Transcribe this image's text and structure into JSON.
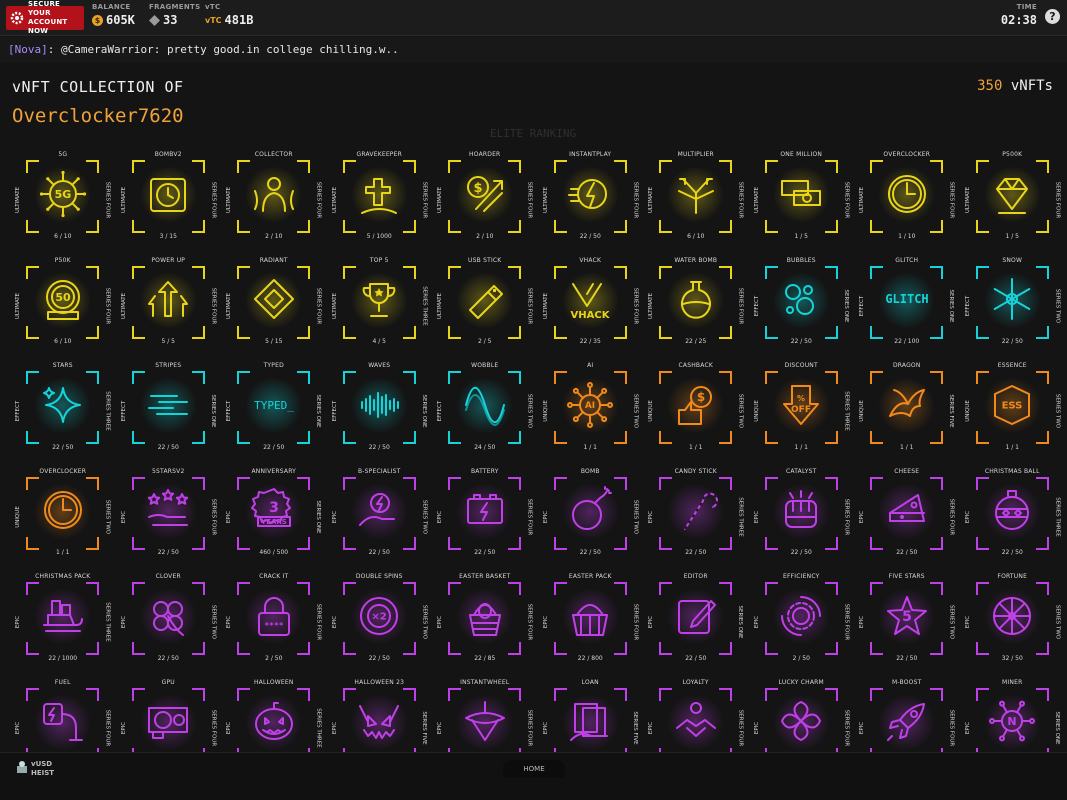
{
  "topbar": {
    "secure_line1": "SECURE YOUR",
    "secure_line2": "ACCOUNT NOW",
    "balance_label": "BALANCE",
    "balance_value": "605K",
    "fragments_label": "FRAGMENTS",
    "fragments_value": "33",
    "vtc_label": "vTC",
    "vtc_value": "481B",
    "time_label": "TIME",
    "time_value": "02:38",
    "help": "?"
  },
  "chat": {
    "channel": "[Nova]",
    "message": ": @CameraWarrior: pretty good.in college chilling.w.."
  },
  "collection": {
    "title": "vNFT COLLECTION OF",
    "owner": "Overclocker7620",
    "count": "350",
    "count_label": "vNFTs",
    "background_heading": "ELITE RANKING"
  },
  "colors": {
    "ultimate": "#e8d51a",
    "effect": "#16d3d8",
    "unique": "#f08a1c",
    "epic": "#c040e8"
  },
  "cards": [
    {
      "name": "5G",
      "tier": "ULTIMATE",
      "series": "SERIES FOUR",
      "count": "6 / 10",
      "rarity": "ultimate",
      "icon": "5g-icon",
      "sym": "5G"
    },
    {
      "name": "BOMBV2",
      "tier": "ULTIMATE",
      "series": "SERIES FOUR",
      "count": "3 / 15",
      "rarity": "ultimate",
      "icon": "time-bomb-icon",
      "sym": "clock"
    },
    {
      "name": "COLLECTOR",
      "tier": "ULTIMATE",
      "series": "SERIES FOUR",
      "count": "2 / 10",
      "rarity": "ultimate",
      "icon": "collector-icon",
      "sym": "person"
    },
    {
      "name": "GRAVEKEEPER",
      "tier": "ULTIMATE",
      "series": "SERIES FOUR",
      "count": "5 / 1000",
      "rarity": "ultimate",
      "icon": "grave-icon",
      "sym": "grave"
    },
    {
      "name": "HOARDER",
      "tier": "ULTIMATE",
      "series": "SERIES FOUR",
      "count": "2 / 10",
      "rarity": "ultimate",
      "icon": "hoarder-icon",
      "sym": "dollar-arrows"
    },
    {
      "name": "INSTANTPLAY",
      "tier": "ULTIMATE",
      "series": "SERIES FOUR",
      "count": "22 / 50",
      "rarity": "ultimate",
      "icon": "instant-play-icon",
      "sym": "bolt-clock"
    },
    {
      "name": "MULTIPLIER",
      "tier": "ULTIMATE",
      "series": "SERIES FOUR",
      "count": "6 / 10",
      "rarity": "ultimate",
      "icon": "multiplier-icon",
      "sym": "arrows"
    },
    {
      "name": "ONE MILLION",
      "tier": "ULTIMATE",
      "series": "SERIES FOUR",
      "count": "1 / 5",
      "rarity": "ultimate",
      "icon": "one-million-icon",
      "sym": "money"
    },
    {
      "name": "OVERCLOCKER",
      "tier": "ULTIMATE",
      "series": "SERIES FOUR",
      "count": "1 / 10",
      "rarity": "ultimate",
      "icon": "clock-icon",
      "sym": "clock-face"
    },
    {
      "name": "P500K",
      "tier": "ULTIMATE",
      "series": "SERIES FOUR",
      "count": "1 / 5",
      "rarity": "ultimate",
      "icon": "diamond-icon",
      "sym": "diamond"
    },
    {
      "name": "P50K",
      "tier": "ULTIMATE",
      "series": "SERIES FOUR",
      "count": "6 / 10",
      "rarity": "ultimate",
      "icon": "p50k-badge-icon",
      "sym": "50"
    },
    {
      "name": "POWER UP",
      "tier": "ULTIMATE",
      "series": "SERIES FOUR",
      "count": "5 / 5",
      "rarity": "ultimate",
      "icon": "power-up-icon",
      "sym": "up-arrows"
    },
    {
      "name": "RADIANT",
      "tier": "ULTIMATE",
      "series": "SERIES FOUR",
      "count": "5 / 15",
      "rarity": "ultimate",
      "icon": "radiant-icon",
      "sym": "rhombus"
    },
    {
      "name": "TOP 5",
      "tier": "ULTIMATE",
      "series": "SERIES THREE",
      "count": "4 / 5",
      "rarity": "ultimate",
      "icon": "trophy-icon",
      "sym": "trophy"
    },
    {
      "name": "USB STICK",
      "tier": "ULTIMATE",
      "series": "SERIES FOUR",
      "count": "2 / 5",
      "rarity": "ultimate",
      "icon": "usb-stick-icon",
      "sym": "usb"
    },
    {
      "name": "VHACK",
      "tier": "ULTIMATE",
      "series": "SERIES FOUR",
      "count": "22 / 35",
      "rarity": "ultimate",
      "icon": "vhack-logo-icon",
      "sym": "vhack"
    },
    {
      "name": "WATER BOMB",
      "tier": "ULTIMATE",
      "series": "SERIES FOUR",
      "count": "22 / 25",
      "rarity": "ultimate",
      "icon": "water-bomb-icon",
      "sym": "flask"
    },
    {
      "name": "BUBBLES",
      "tier": "EFFECT",
      "series": "SERIES ONE",
      "count": "22 / 50",
      "rarity": "effect",
      "icon": "bubbles-icon",
      "sym": "bubbles"
    },
    {
      "name": "GLITCH",
      "tier": "EFFECT",
      "series": "SERIES ONE",
      "count": "22 / 100",
      "rarity": "effect",
      "icon": "glitch-icon",
      "sym": "GLITCH"
    },
    {
      "name": "SNOW",
      "tier": "EFFECT",
      "series": "SERIES TWO",
      "count": "22 / 50",
      "rarity": "effect",
      "icon": "snowflake-icon",
      "sym": "snow"
    },
    {
      "name": "STARS",
      "tier": "EFFECT",
      "series": "SERIES THREE",
      "count": "22 / 50",
      "rarity": "effect",
      "icon": "stars-icon",
      "sym": "stars"
    },
    {
      "name": "STRIPES",
      "tier": "EFFECT",
      "series": "SERIES ONE",
      "count": "22 / 50",
      "rarity": "effect",
      "icon": "stripes-icon",
      "sym": "stripes"
    },
    {
      "name": "TYPED",
      "tier": "EFFECT",
      "series": "SERIES ONE",
      "count": "22 / 50",
      "rarity": "effect",
      "icon": "typed-icon",
      "sym": "TYPED_"
    },
    {
      "name": "WAVES",
      "tier": "EFFECT",
      "series": "SERIES ONE",
      "count": "22 / 50",
      "rarity": "effect",
      "icon": "sound-wave-icon",
      "sym": "wave"
    },
    {
      "name": "WOBBLE",
      "tier": "EFFECT",
      "series": "SERIES TWO",
      "count": "24 / 50",
      "rarity": "effect",
      "icon": "wobble-icon",
      "sym": "sine"
    },
    {
      "name": "AI",
      "tier": "UNIQUE",
      "series": "SERIES TWO",
      "count": "1 / 1",
      "rarity": "unique",
      "icon": "ai-chip-icon",
      "sym": "AI"
    },
    {
      "name": "CASHBACK",
      "tier": "UNIQUE",
      "series": "SERIES TWO",
      "count": "1 / 1",
      "rarity": "unique",
      "icon": "cashback-icon",
      "sym": "thumb-dollar"
    },
    {
      "name": "DISCOUNT",
      "tier": "UNIQUE",
      "series": "SERIES THREE",
      "count": "1 / 1",
      "rarity": "unique",
      "icon": "discount-icon",
      "sym": "OFF"
    },
    {
      "name": "DRAGON",
      "tier": "UNIQUE",
      "series": "SERIES FIVE",
      "count": "1 / 1",
      "rarity": "unique",
      "icon": "dragon-icon",
      "sym": "dragon"
    },
    {
      "name": "ESSENCE",
      "tier": "UNIQUE",
      "series": "SERIES TWO",
      "count": "1 / 1",
      "rarity": "unique",
      "icon": "essence-icon",
      "sym": "ess"
    },
    {
      "name": "OVERCLOCKER",
      "tier": "UNIQUE",
      "series": "SERIES TWO",
      "count": "1 / 1",
      "rarity": "unique",
      "icon": "clock-icon",
      "sym": "clock-face"
    },
    {
      "name": "5STARSV2",
      "tier": "EPIC",
      "series": "SERIES FOUR",
      "count": "22 / 50",
      "rarity": "epic",
      "icon": "five-stars-icon",
      "sym": "5stars"
    },
    {
      "name": "ANNIVERSARY",
      "tier": "EPIC",
      "series": "SERIES ONE",
      "count": "460 / 500",
      "rarity": "epic",
      "icon": "anniversary-badge-icon",
      "sym": "3years"
    },
    {
      "name": "B-SPECIALIST",
      "tier": "EPIC",
      "series": "SERIES TWO",
      "count": "22 / 50",
      "rarity": "epic",
      "icon": "b-specialist-icon",
      "sym": "hand-bolt"
    },
    {
      "name": "BATTERY",
      "tier": "EPIC",
      "series": "SERIES FOUR",
      "count": "22 / 50",
      "rarity": "epic",
      "icon": "battery-icon",
      "sym": "battery"
    },
    {
      "name": "BOMB",
      "tier": "EPIC",
      "series": "SERIES TWO",
      "count": "22 / 50",
      "rarity": "epic",
      "icon": "bomb-icon",
      "sym": "bomb"
    },
    {
      "name": "CANDY STICK",
      "tier": "EPIC",
      "series": "SERIES THREE",
      "count": "22 / 50",
      "rarity": "epic",
      "icon": "candy-cane-icon",
      "sym": "cane"
    },
    {
      "name": "CATALYST",
      "tier": "EPIC",
      "series": "SERIES FOUR",
      "count": "22 / 50",
      "rarity": "epic",
      "icon": "catalyst-icon",
      "sym": "fist"
    },
    {
      "name": "CHEESE",
      "tier": "EPIC",
      "series": "SERIES FOUR",
      "count": "22 / 50",
      "rarity": "epic",
      "icon": "cheese-icon",
      "sym": "cheese"
    },
    {
      "name": "CHRISTMAS BALL",
      "tier": "EPIC",
      "series": "SERIES THREE",
      "count": "22 / 50",
      "rarity": "epic",
      "icon": "christmas-ball-icon",
      "sym": "ornament"
    },
    {
      "name": "CHRISTMAS PACK",
      "tier": "EPIC",
      "series": "SERIES THREE",
      "count": "22 / 1000",
      "rarity": "epic",
      "icon": "sleigh-icon",
      "sym": "sleigh"
    },
    {
      "name": "CLOVER",
      "tier": "EPIC",
      "series": "SERIES TWO",
      "count": "22 / 50",
      "rarity": "epic",
      "icon": "clover-icon",
      "sym": "clover"
    },
    {
      "name": "CRACK IT",
      "tier": "EPIC",
      "series": "SERIES FOUR",
      "count": "2 / 50",
      "rarity": "epic",
      "icon": "padlock-icon",
      "sym": "lock"
    },
    {
      "name": "DOUBLE SPINS",
      "tier": "EPIC",
      "series": "SERIES TWO",
      "count": "22 / 50",
      "rarity": "epic",
      "icon": "double-spins-icon",
      "sym": "x2"
    },
    {
      "name": "EASTER BASKET",
      "tier": "EPIC",
      "series": "SERIES FOUR",
      "count": "22 / 85",
      "rarity": "epic",
      "icon": "easter-basket-icon",
      "sym": "basket"
    },
    {
      "name": "EASTER PACK",
      "tier": "EPIC",
      "series": "SERIES FOUR",
      "count": "22 / 800",
      "rarity": "epic",
      "icon": "easter-pack-icon",
      "sym": "basket2"
    },
    {
      "name": "EDITOR",
      "tier": "EPIC",
      "series": "SERIES ONE",
      "count": "22 / 50",
      "rarity": "epic",
      "icon": "editor-icon",
      "sym": "pencil"
    },
    {
      "name": "EFFICIENCY",
      "tier": "EPIC",
      "series": "SERIES FOUR",
      "count": "2 / 50",
      "rarity": "epic",
      "icon": "gear-cycle-icon",
      "sym": "gear"
    },
    {
      "name": "FIVE STARS",
      "tier": "EPIC",
      "series": "SERIES TWO",
      "count": "22 / 50",
      "rarity": "epic",
      "icon": "five-star-badge-icon",
      "sym": "star5"
    },
    {
      "name": "FORTUNE",
      "tier": "EPIC",
      "series": "SERIES TWO",
      "count": "32 / 50",
      "rarity": "epic",
      "icon": "fortune-wheel-icon",
      "sym": "wheel"
    },
    {
      "name": "FUEL",
      "tier": "EPIC",
      "series": "SERIES FOUR",
      "count": "",
      "rarity": "epic",
      "icon": "fuel-plug-icon",
      "sym": "plug"
    },
    {
      "name": "GPU",
      "tier": "EPIC",
      "series": "SERIES FOUR",
      "count": "",
      "rarity": "epic",
      "icon": "gpu-icon",
      "sym": "gpu"
    },
    {
      "name": "HALLOWEEN",
      "tier": "EPIC",
      "series": "SERIES THREE",
      "count": "",
      "rarity": "epic",
      "icon": "pumpkin-icon",
      "sym": "pumpkin"
    },
    {
      "name": "HALLOWEEN 23",
      "tier": "EPIC",
      "series": "SERIES FIVE",
      "count": "",
      "rarity": "epic",
      "icon": "monster-face-icon",
      "sym": "monster"
    },
    {
      "name": "INSTANTWHEEL",
      "tier": "EPIC",
      "series": "SERIES FOUR",
      "count": "",
      "rarity": "epic",
      "icon": "spinning-top-icon",
      "sym": "top"
    },
    {
      "name": "LOAN",
      "tier": "EPIC",
      "series": "SERIES FIVE",
      "count": "",
      "rarity": "epic",
      "icon": "loan-icon",
      "sym": "loan"
    },
    {
      "name": "LOYALTY",
      "tier": "EPIC",
      "series": "SERIES FOUR",
      "count": "",
      "rarity": "epic",
      "icon": "handshake-icon",
      "sym": "handshake"
    },
    {
      "name": "LUCKY CHARM",
      "tier": "EPIC",
      "series": "SERIES FOUR",
      "count": "",
      "rarity": "epic",
      "icon": "knot-icon",
      "sym": "knot"
    },
    {
      "name": "M-BOOST",
      "tier": "EPIC",
      "series": "SERIES FOUR",
      "count": "",
      "rarity": "epic",
      "icon": "rocket-icon",
      "sym": "rocket"
    },
    {
      "name": "MINER",
      "tier": "EPIC",
      "series": "SERIES ONE",
      "count": "",
      "rarity": "epic",
      "icon": "network-node-icon",
      "sym": "node"
    }
  ],
  "bottombar": {
    "vusd_line1": "vUSD",
    "vusd_line2": "HEIST",
    "home": "HOME"
  }
}
